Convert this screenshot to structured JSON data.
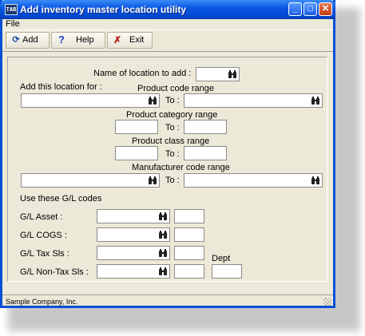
{
  "window": {
    "title": "Add inventory master location utility",
    "icon_text": "TAB",
    "controls": {
      "minimize": "_",
      "maximize": "□",
      "close": "✕"
    }
  },
  "menu": {
    "file": "File"
  },
  "toolbar": {
    "add_label": "Add",
    "help_label": "Help",
    "exit_label": "Exit"
  },
  "form": {
    "location_label": "Name of location to add :",
    "add_for_label": "Add this location for :",
    "product_code_range_label": "Product code range",
    "product_category_range_label": "Product category range",
    "product_class_range_label": "Product class range",
    "manufacturer_code_range_label": "Manufacturer code range",
    "to_label": "To :",
    "gl_codes_label": "Use these G/L codes",
    "gl_asset_label": "G/L Asset :",
    "gl_cogs_label": "G/L COGS :",
    "gl_tax_sls_label": "G/L Tax Sls :",
    "gl_nontax_sls_label": "G/L Non-Tax Sls :",
    "dept_label": "Dept",
    "values": {
      "location": "",
      "product_code_from": "",
      "product_code_to": "",
      "product_category_from": "",
      "product_category_to": "",
      "product_class_from": "",
      "product_class_to": "",
      "manufacturer_from": "",
      "manufacturer_to": "",
      "gl_asset": "",
      "gl_asset_dept": "",
      "gl_cogs": "",
      "gl_cogs_dept": "",
      "gl_tax_sls": "",
      "gl_tax_sls_dept": "",
      "gl_nontax_sls": "",
      "gl_nontax_sls_dept": "",
      "dept": ""
    }
  },
  "status": {
    "company": "Sample Company, Inc."
  },
  "icons": {
    "lookup": "binoculars-icon",
    "add": "refresh-icon",
    "help": "question-icon",
    "exit": "x-icon"
  }
}
